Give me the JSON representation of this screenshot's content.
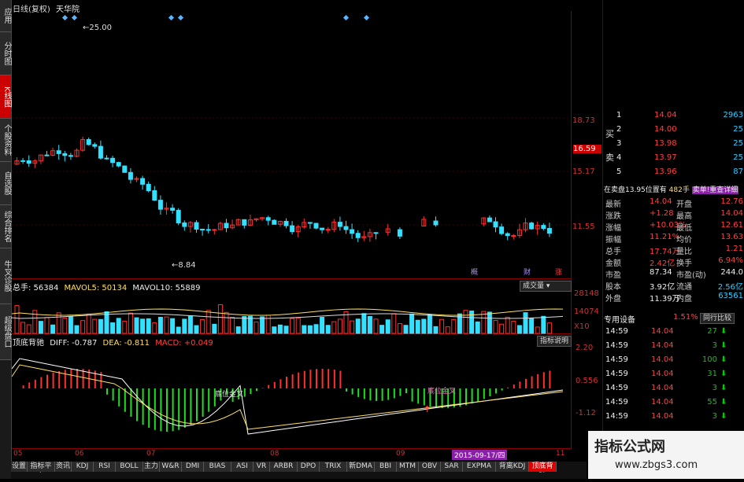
{
  "window": {
    "title": "日线(复权)",
    "stock_name": "天华院"
  },
  "sidebar": {
    "items": [
      "应用",
      "分时图",
      "K线图",
      "个股资料",
      "自选股",
      "综合排名",
      "牛叉诊股",
      "超级盘口"
    ],
    "active_index": 2
  },
  "price_chart": {
    "high_label": "25.00",
    "low_label": "8.84",
    "price_ticks": [
      "18.73",
      "16.59",
      "15.17",
      "11.55"
    ],
    "marks": [
      "概",
      "财",
      "涨"
    ]
  },
  "volume": {
    "total_label": "总手: 56384",
    "ma5_label": "MAVOL5: 50134",
    "ma10_label": "MAVOL10: 55889",
    "ticks": [
      "28148",
      "14074",
      "X10"
    ],
    "button": "成交量"
  },
  "macd": {
    "title": "顶底背驰",
    "diff_label": "DIFF: -0.787",
    "dea_label": "DEA: -0.811",
    "macd_label": "MACD: +0.049",
    "ticks": [
      "2.20",
      "0.556",
      "-1.12"
    ],
    "button": "指标说明",
    "cross_text_1": "底位金叉",
    "cross_text_2": "底位金叉"
  },
  "x_axis": {
    "labels": [
      "05",
      "06",
      "07",
      "08",
      "09",
      "11"
    ],
    "highlight_date": "2015-09-17/四"
  },
  "order_book": {
    "sell_label": "卖",
    "buy_label": "买",
    "rows": [
      {
        "n": "1",
        "price": "14.04",
        "vol": "2963"
      },
      {
        "n": "2",
        "price": "14.00",
        "vol": "25"
      },
      {
        "n": "3",
        "price": "13.98",
        "vol": "25"
      },
      {
        "n": "4",
        "price": "13.97",
        "vol": "25"
      },
      {
        "n": "5",
        "price": "13.96",
        "vol": "87"
      }
    ],
    "info_line": "在卖盘13.95位置有",
    "info_count": "482手",
    "info_link": "卖单!重查详细"
  },
  "quote": {
    "rows": [
      {
        "k1": "最新",
        "v1": "14.04",
        "k2": "开盘",
        "v2": "12.76"
      },
      {
        "k1": "涨跌",
        "v1": "+1.28",
        "k2": "最高",
        "v2": "14.04"
      },
      {
        "k1": "涨幅",
        "v1": "+10.03%",
        "k2": "最低",
        "v2": "12.61"
      },
      {
        "k1": "振幅",
        "v1": "11.21%",
        "k2": "均价",
        "v2": "13.63"
      },
      {
        "k1": "总手",
        "v1": "17.74万",
        "k2": "量比",
        "v2": "1.21"
      },
      {
        "k1": "金额",
        "v1": "2.42亿",
        "k2": "换手",
        "v2": "6.94%"
      },
      {
        "k1": "市盈",
        "v1": "87.34",
        "k2": "市盈(动)",
        "v2": "244.0"
      },
      {
        "k1": "股本",
        "v1": "3.92亿",
        "k2": "流通",
        "v2": "2.56亿"
      },
      {
        "k1": "外盘",
        "v1": "11.39万",
        "k2": "内盘",
        "v2": "63561"
      }
    ]
  },
  "special": {
    "label": "专用设备",
    "pct": "1.51%",
    "button": "同行比较"
  },
  "ticks": [
    {
      "t": "14:59",
      "p": "14.04",
      "v": "27"
    },
    {
      "t": "14:59",
      "p": "14.04",
      "v": "3"
    },
    {
      "t": "14:59",
      "p": "14.04",
      "v": "100"
    },
    {
      "t": "14:59",
      "p": "14.04",
      "v": "31"
    },
    {
      "t": "14:59",
      "p": "14.04",
      "v": "3"
    },
    {
      "t": "14:59",
      "p": "14.04",
      "v": "55"
    },
    {
      "t": "14:59",
      "p": "14.04",
      "v": "3"
    }
  ],
  "bottom_tabs": [
    "设置",
    "指标平台",
    "资讯",
    "KDJ",
    "RSI",
    "BOLL",
    "主力",
    "W&R",
    "DMI",
    "BIAS",
    "ASI",
    "VR",
    "ARBR",
    "DPO",
    "TRIX",
    "新DMA",
    "BBI",
    "MTM",
    "OBV",
    "SAR",
    "EXPMA",
    "背离KDJ",
    "顶底背驰"
  ],
  "active_tab": "顶底背驰",
  "watermark": {
    "title": "指标公式网",
    "url": "www.zbgs3.com"
  },
  "colors": {
    "up": "#ff3030",
    "down": "#33e0ff",
    "grid": "#8b0000",
    "macd_up": "#ff3030",
    "macd_down": "#22dd22"
  }
}
